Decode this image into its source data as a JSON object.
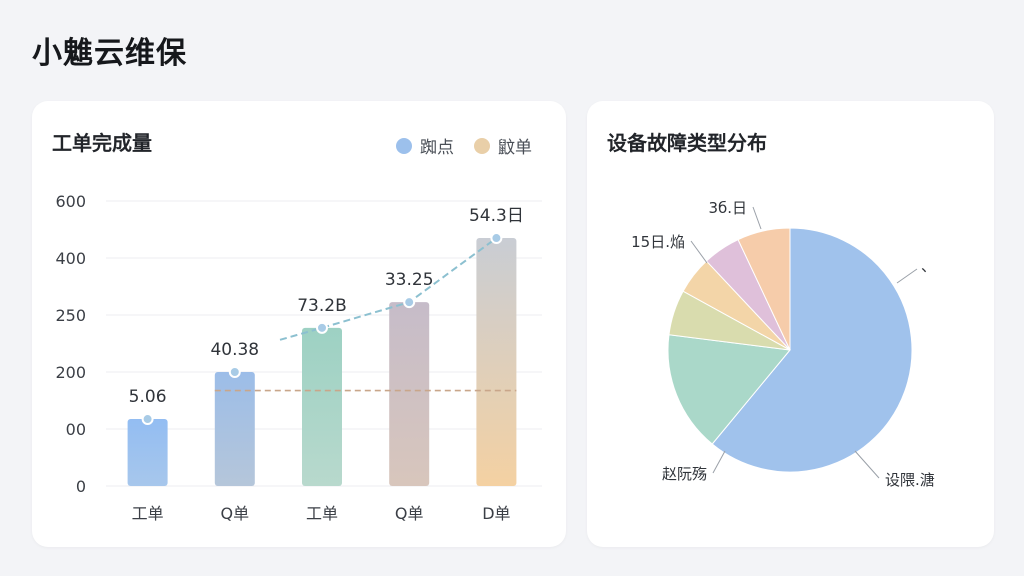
{
  "app": {
    "title": "小魋云维保"
  },
  "bar_card": {
    "title": "工单完成量",
    "legend": [
      {
        "label": "踟点",
        "color": "#9cc0ec"
      },
      {
        "label": "鼤单",
        "color": "#e9cfa8"
      }
    ]
  },
  "pie_card": {
    "title": "设备故障类型分布"
  },
  "chart_data": [
    {
      "type": "bar",
      "title": "工单完成量",
      "categories": [
        "工单",
        "Q单",
        "工单",
        "Q单",
        "D单"
      ],
      "y_tick_labels": [
        "600",
        "400",
        "250",
        "200",
        "00",
        "0"
      ],
      "values": [
        0.235,
        0.4,
        0.555,
        0.645,
        0.87
      ],
      "data_labels": [
        "5.06",
        "40.38",
        "73.2B",
        "33.25",
        "54.3日"
      ],
      "bar_colors": [
        [
          "#93bdf2",
          "#a7c7ec"
        ],
        [
          "#9cbde8",
          "#b5c6da"
        ],
        [
          "#9dd1c3",
          "#b8d9cd"
        ],
        [
          "#c6bcc9",
          "#d8c6bc"
        ],
        [
          "#c9cdd4",
          "#f4d1a2"
        ]
      ],
      "trend_line_color": "#8cc0d0",
      "reference_line": {
        "value": 0.335,
        "color": "#c9a68a"
      },
      "ylim": [
        0,
        1
      ],
      "grid": true
    },
    {
      "type": "pie",
      "title": "设备故障类型分布",
      "slices": [
        {
          "label": "设隈.溏",
          "value": 61,
          "color": "#a0c2ec"
        },
        {
          "label": "赵阮殇",
          "value": 16,
          "color": "#aad8c9"
        },
        {
          "label": "",
          "value": 6,
          "color": "#d9dcae"
        },
        {
          "label": "",
          "value": 5,
          "color": "#f3d5a8"
        },
        {
          "label": "15日.焔",
          "value": 5,
          "color": "#dfc0da"
        },
        {
          "label": "3б.日",
          "value": 7,
          "color": "#f6ccaa"
        }
      ],
      "top_right_mark": "、"
    }
  ]
}
